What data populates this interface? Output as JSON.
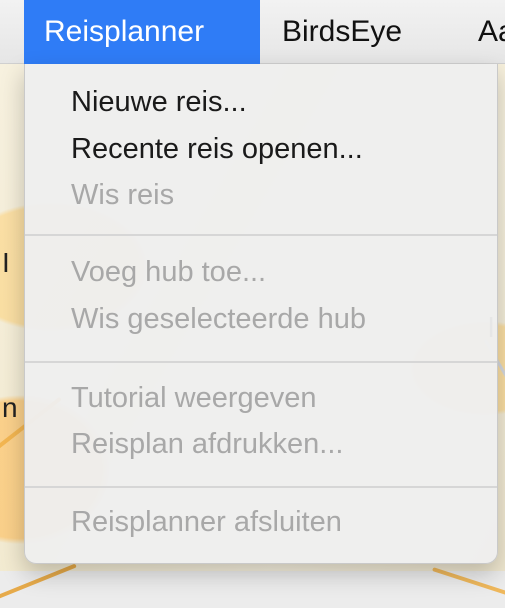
{
  "menubar": {
    "items": [
      {
        "label": "Reisplanner",
        "active": true
      },
      {
        "label": "BirdsEye",
        "active": false
      },
      {
        "label": "Aa",
        "active": false
      }
    ],
    "accent_color": "#2f7cf6"
  },
  "menu": {
    "title": "Reisplanner",
    "groups": [
      {
        "items": [
          {
            "label": "Nieuwe reis...",
            "enabled": true
          },
          {
            "label": "Recente reis openen...",
            "enabled": true
          },
          {
            "label": "Wis reis",
            "enabled": false
          }
        ]
      },
      {
        "items": [
          {
            "label": "Voeg hub toe...",
            "enabled": false
          },
          {
            "label": "Wis geselecteerde hub",
            "enabled": false
          }
        ]
      },
      {
        "items": [
          {
            "label": "Tutorial weergeven",
            "enabled": false
          },
          {
            "label": "Reisplan afdrukken...",
            "enabled": false
          }
        ]
      },
      {
        "items": [
          {
            "label": "Reisplanner afsluiten",
            "enabled": false
          }
        ]
      }
    ]
  }
}
